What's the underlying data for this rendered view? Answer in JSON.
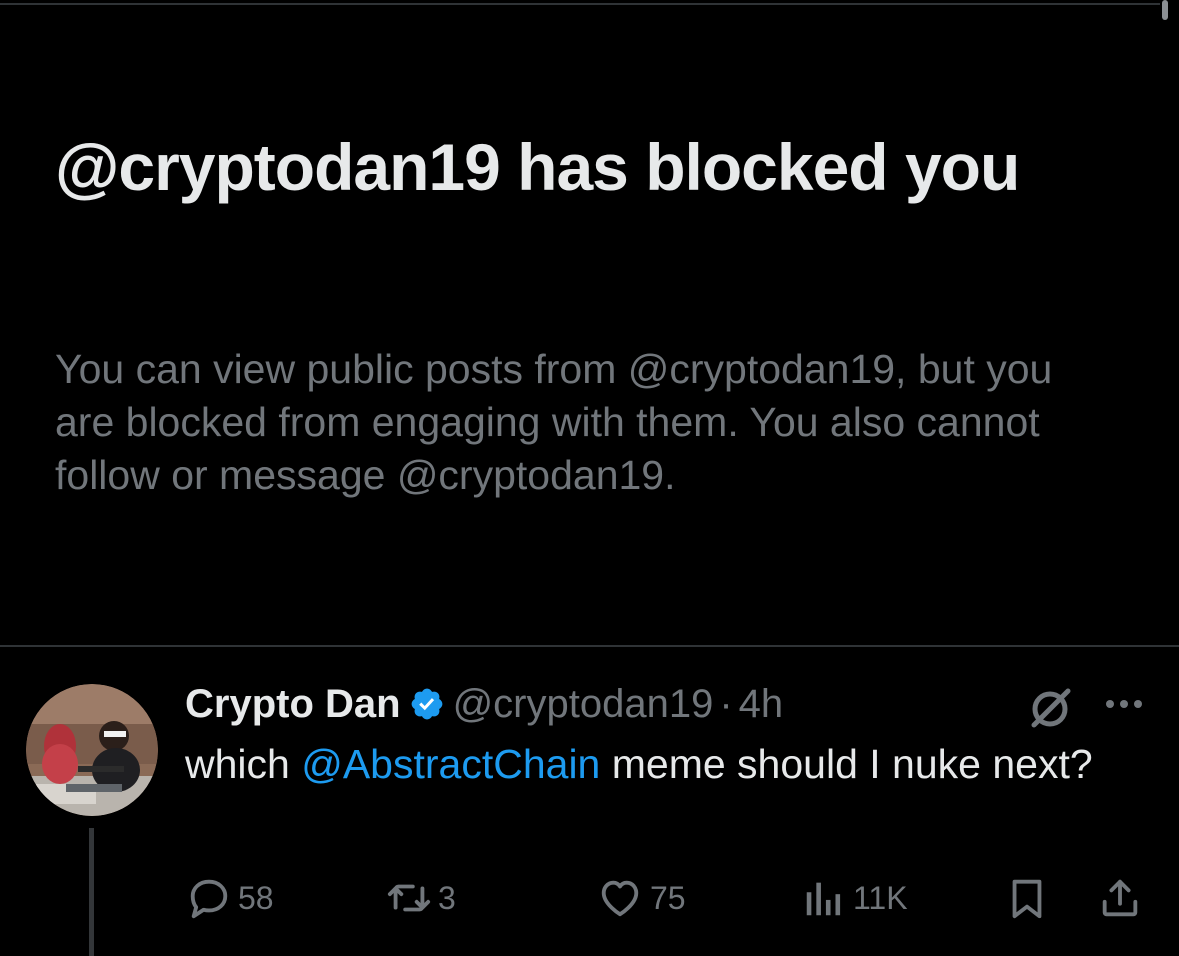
{
  "block_notice": {
    "title": "@cryptodan19 has blocked you",
    "description": "You can view public posts from @cryptodan19, but you are blocked from engaging with them. You also cannot follow or message @cryptodan19."
  },
  "post": {
    "display_name": "Crypto Dan",
    "verified_icon": "verified-badge-icon",
    "handle": "@cryptodan19",
    "separator": "·",
    "time": "4h",
    "text_before": "which ",
    "mention": "@AbstractChain",
    "text_after": " meme should I nuke next?",
    "actions": {
      "replies": "58",
      "reposts": "3",
      "likes": "75",
      "views": "11K"
    }
  },
  "colors": {
    "background": "#000000",
    "primary_text": "#e7e9ea",
    "secondary_text": "#71767b",
    "accent": "#1d9bf0",
    "divider": "#2f3336"
  }
}
